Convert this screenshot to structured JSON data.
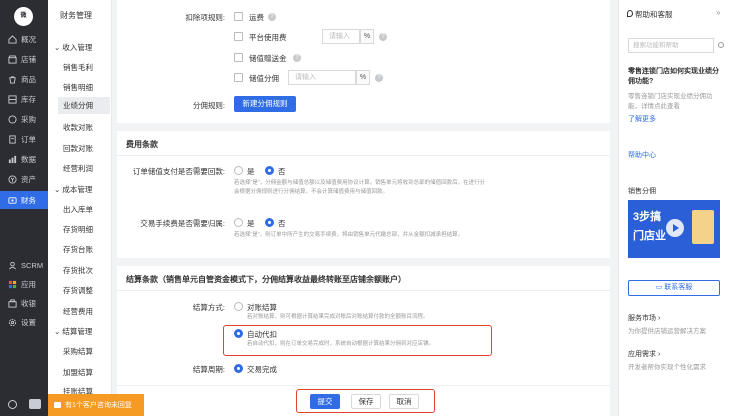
{
  "leftnav": {
    "logo": "微",
    "items": [
      {
        "label": "概况",
        "icon": "home-icon"
      },
      {
        "label": "店铺",
        "icon": "store-icon"
      },
      {
        "label": "商品",
        "icon": "goods-icon"
      },
      {
        "label": "库存",
        "icon": "inventory-icon"
      },
      {
        "label": "采购",
        "icon": "purchase-icon"
      },
      {
        "label": "订单",
        "icon": "order-icon"
      },
      {
        "label": "数据",
        "icon": "data-icon"
      },
      {
        "label": "资产",
        "icon": "asset-icon"
      },
      {
        "label": "财务",
        "icon": "finance-icon"
      },
      {
        "label": "SCRM",
        "icon": "scrm-icon"
      },
      {
        "label": "应用",
        "icon": "apps-icon"
      },
      {
        "label": "收银",
        "icon": "cashier-icon"
      },
      {
        "label": "设置",
        "icon": "settings-icon"
      }
    ]
  },
  "subnav": {
    "title": "财务管理",
    "groups": [
      {
        "label": "收入管理",
        "items": [
          "销售毛利",
          "销售明细",
          "业绩分佣",
          "收款对账",
          "回款对账",
          "经营利润"
        ]
      },
      {
        "label": "成本管理",
        "items": [
          "出入库单",
          "存货明细",
          "存货台账",
          "存货批次",
          "存货调整",
          "经营费用"
        ]
      },
      {
        "label": "结算管理",
        "items": [
          "采购结算",
          "加盟结算",
          "挂账结算"
        ]
      }
    ]
  },
  "form": {
    "deduct_label": "扣除项规则:",
    "deduct_items": [
      {
        "label": "运费"
      },
      {
        "label": "平台使用费",
        "placeholder": "请输入",
        "unit": "%"
      },
      {
        "label": "储值赠送金"
      },
      {
        "label": "储值分佣",
        "placeholder": "请输入",
        "unit": "%"
      }
    ],
    "commission_label": "分佣规则:",
    "new_rule_button": "新建分佣规则"
  },
  "fee_section": {
    "title": "费用条款",
    "q1_label": "订单储值支付是否需要回款:",
    "q1_options": [
      "是",
      "否"
    ],
    "q1_note_1": "若选择“是”，分佣金额与储值总额以及储值费用协议计算。销售单元将收到总部的储值回款后，在进行分佣；若选择“否”，则系统只",
    "q1_note_2": "会根据分佣规则进行分佣结算，不会计算储值费用与储值回款。",
    "q2_label": "交易手续费是否需要归属:",
    "q2_options": [
      "是",
      "否"
    ],
    "q2_note": "若选择“是”，则订单中所产生的交易手续费，将由销售单元代缴总部，并从金额扣减承担结算。"
  },
  "settle_section": {
    "title": "结算条款（销售单元自管资金模式下，分佣结算收益最终转账至店铺余额账户）",
    "method_label": "结算方式:",
    "opt1": "对账结算",
    "opt1_note": "若对账结算，则可根据计算结果完成对账后对账结算付款的全额账目流程。",
    "opt2": "自动代扣",
    "opt2_note": "若自动代扣，则在订单交易完成时，系统自动根据计算结果分佣到对应店铺。",
    "cycle_label": "结算周期:",
    "cycle_value": "交易完成"
  },
  "actions": {
    "submit": "提交",
    "save": "保存",
    "cancel": "取消"
  },
  "right_panel": {
    "title": "帮助和客服",
    "collapse": "»",
    "search_placeholder": "搜索功能和帮助",
    "faq_title_1": "零售连锁门店如何实现业绩分",
    "faq_title_2": "佣功能?",
    "faq_desc_1": "零售连锁门店实现业绩分佣功",
    "faq_desc_2": "能，详情点此查看",
    "learn_more": "了解更多",
    "help_center": "帮助中心",
    "video_title": "销售分佣",
    "video_caption_1": "3步搞",
    "video_caption_2": "门店业",
    "contact_button": "联系客服",
    "market_title": "服务市场 ›",
    "market_desc": "为你提供店铺运营解决方案",
    "req_title": "应用需求 ›",
    "req_desc": "开发者帮你实现个性化需求"
  },
  "toast": "有1个客户咨询未回复",
  "colors": {
    "primary": "#2f6ce5",
    "highlight": "#e0452b",
    "nav_bg": "#2b2d33",
    "toast": "#f59a23"
  }
}
